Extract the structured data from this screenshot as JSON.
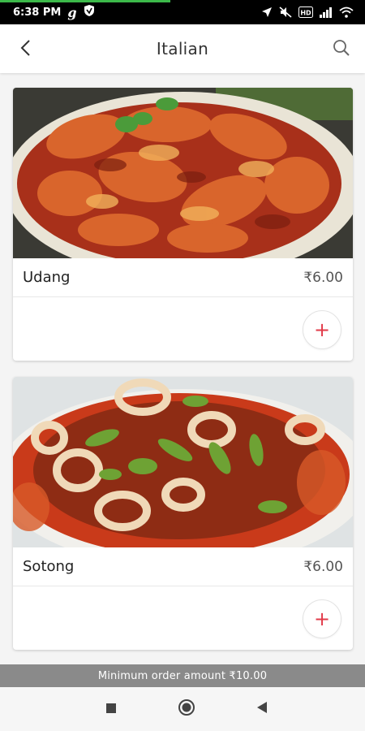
{
  "status_bar": {
    "time": "6:38 PM",
    "left_icons": [
      "g-icon",
      "vpn-shield-icon"
    ],
    "right_icons": [
      "location-icon",
      "mute-icon",
      "volte-icon",
      "signal-icon",
      "wifi-icon"
    ]
  },
  "header": {
    "title": "Italian",
    "back_icon": "chevron-left-icon",
    "search_icon": "search-icon"
  },
  "items": [
    {
      "name": "Udang",
      "price": "₹6.00",
      "add_label": "+"
    },
    {
      "name": "Sotong",
      "price": "₹6.00",
      "add_label": "+"
    }
  ],
  "footer": {
    "min_order": "Minimum order amount ₹10.00"
  },
  "nav": {
    "icons": [
      "recents-square-icon",
      "home-circle-icon",
      "back-triangle-icon"
    ]
  },
  "colors": {
    "accent": "#e23b4a",
    "status_progress": "#3cb94a",
    "min_order_bg": "#8a8a8a"
  }
}
